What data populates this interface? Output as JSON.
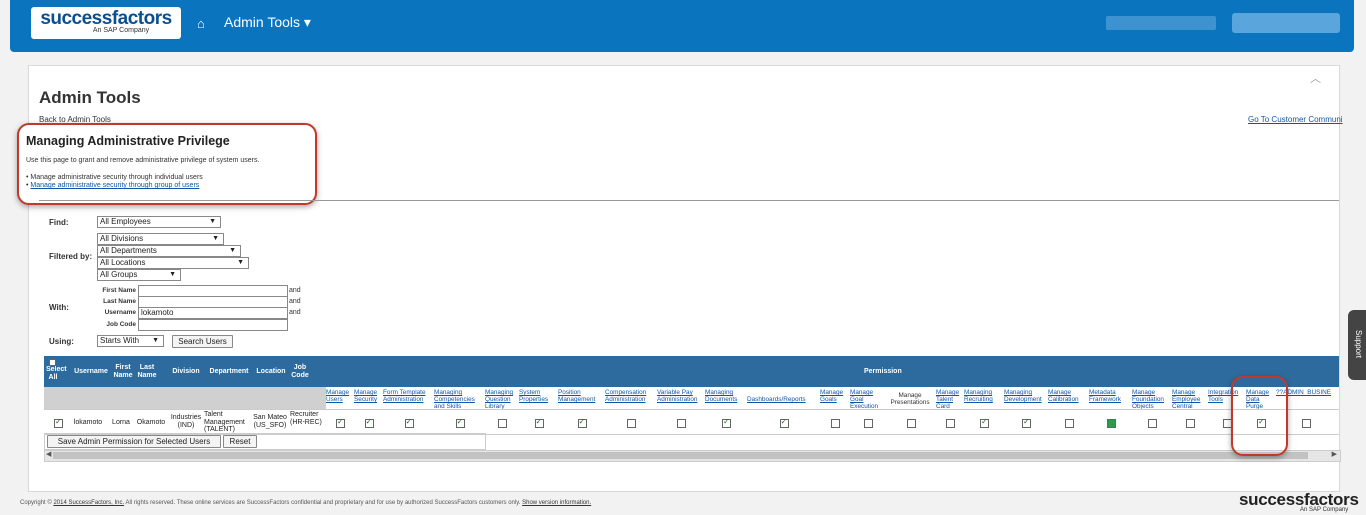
{
  "header": {
    "logo": "successfactors",
    "logo_sub": "An SAP Company",
    "menu_label": "Admin Tools ▾"
  },
  "page": {
    "title": "Admin Tools",
    "back_link": "Back to Admin Tools",
    "customer_link": "Go To Customer Communi"
  },
  "privilege": {
    "title": "Managing Administrative Privilege",
    "description": "Use this page to grant and remove administrative privilege of system users.",
    "items": [
      {
        "prefix": "• ",
        "text": "Manage administrative security through individual users",
        "link": false
      },
      {
        "prefix": "• ",
        "text": "Manage administrative security through group of users",
        "link": true
      }
    ]
  },
  "form": {
    "find_label": "Find:",
    "find_value": "All Employees",
    "filtered_label": "Filtered by:",
    "divisions": "All Divisions",
    "departments": "All Departments",
    "locations": "All Locations",
    "groups": "All Groups",
    "with_label": "With:",
    "first_name_label": "First Name",
    "last_name_label": "Last Name",
    "username_label": "Username",
    "username_value": "lokamoto",
    "job_code_label": "Job Code",
    "and": "and",
    "using_label": "Using:",
    "using_value": "Starts With",
    "search_button": "Search Users"
  },
  "grid": {
    "headers": {
      "select_all": "Select All",
      "username": "Username",
      "first_name": "First Name",
      "last_name": "Last Name",
      "division": "Division",
      "department": "Department",
      "location": "Location",
      "job_code": "Job Code",
      "permission": "Permission"
    },
    "permissions": [
      {
        "label": "Manage Users",
        "checked": true
      },
      {
        "label": "Manage Security",
        "checked": true
      },
      {
        "label": "Form Template Administration",
        "checked": true
      },
      {
        "label": "Managing Competencies and Skills",
        "checked": true
      },
      {
        "label": "Managing Question Library",
        "checked": false
      },
      {
        "label": "System Properties",
        "checked": true
      },
      {
        "label": "Position Management",
        "checked": true
      },
      {
        "label": "Compensation Administration",
        "checked": false
      },
      {
        "label": "Variable Pay Administration",
        "checked": false
      },
      {
        "label": "Managing Documents",
        "checked": true
      },
      {
        "label": "Dashboards/Reports",
        "checked": true
      },
      {
        "label": "Manage Goals",
        "checked": false
      },
      {
        "label": "Manage Goal Execution",
        "checked": false
      },
      {
        "label": "Manage Presentations",
        "checked": false,
        "plain": true
      },
      {
        "label": "Manage Talent Card",
        "checked": false
      },
      {
        "label": "Managing Recruiting",
        "checked": true
      },
      {
        "label": "Managing Development",
        "checked": true
      },
      {
        "label": "Manage Calibration",
        "checked": false
      },
      {
        "label": "Metadata Framework",
        "checked": true,
        "filled": true
      },
      {
        "label": "Manage Foundation Objects",
        "checked": false
      },
      {
        "label": "Manage Employee Central",
        "checked": false
      },
      {
        "label": "Integration Tools",
        "checked": false
      },
      {
        "label": "Manage Data Purge",
        "checked": true
      },
      {
        "label": "??ADMIN_BUSINE",
        "checked": false
      }
    ],
    "row": {
      "username": "lokamoto",
      "first_name": "Lorna",
      "last_name": "Okamoto",
      "division": "Industries (IND)",
      "department": "Talent Management (TALENT)",
      "location": "San Mateo (US_SFO)",
      "job_code": "Recruiter (HR-REC)"
    },
    "save_button": "Save Admin Permission for Selected Users",
    "reset_button": "Reset"
  },
  "support_label": "Support",
  "footer": {
    "text_pre": "Copyright © ",
    "copyright_link": "2014 SuccessFactors, Inc.",
    "text_mid": " All rights reserved. These online services are SuccessFactors confidential and proprietary and for use by authorized SuccessFactors customers only. ",
    "version_link": "Show version information.",
    "logo": "successfactors",
    "logo_sub": "An SAP Company"
  }
}
